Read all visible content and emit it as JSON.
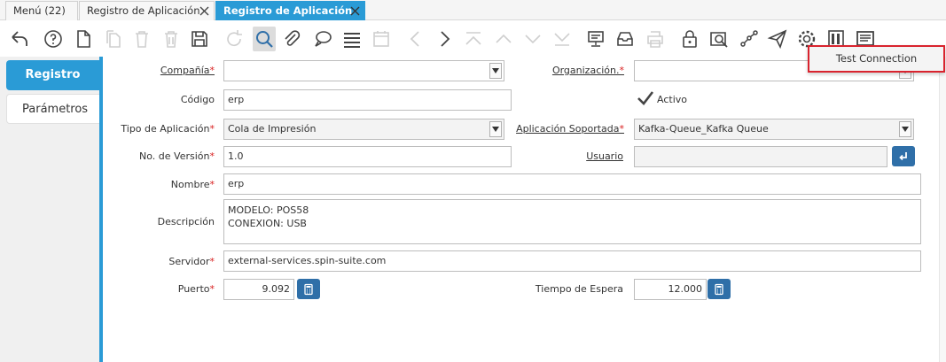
{
  "tabs": [
    {
      "label": "Menú (22)"
    },
    {
      "label": "Registro de Aplicación"
    },
    {
      "label": "Registro de Aplicación"
    }
  ],
  "left_tabs": [
    {
      "label": "Registro"
    },
    {
      "label": "Parámetros"
    }
  ],
  "form": {
    "compania": {
      "label": "Compañía",
      "value": ""
    },
    "organizacion": {
      "label": "Organización.",
      "value": ""
    },
    "codigo": {
      "label": "Código",
      "value": "erp"
    },
    "activo": {
      "label": "Activo",
      "checked": true
    },
    "tipo_aplicacion": {
      "label": "Tipo de Aplicación",
      "value": "Cola de Impresión"
    },
    "aplicacion_soportada": {
      "label": "Aplicación Soportada",
      "value": "Kafka-Queue_Kafka Queue"
    },
    "no_version": {
      "label": "No. de Versión",
      "value": "1.0"
    },
    "usuario": {
      "label": "Usuario",
      "value": ""
    },
    "nombre": {
      "label": "Nombre",
      "value": "erp"
    },
    "descripcion": {
      "label": "Descripción",
      "value": "MODELO: POS58\nCONEXION: USB"
    },
    "servidor": {
      "label": "Servidor",
      "value": "external-services.spin-suite.com"
    },
    "puerto": {
      "label": "Puerto",
      "value": "9.092"
    },
    "tiempo_espera": {
      "label": "Tiempo de Espera",
      "value": "12.000"
    }
  },
  "required_mark": "*",
  "popup": {
    "label": "Test Connection"
  },
  "colors": {
    "accent": "#2a9bd6",
    "required": "#d81e1e",
    "popup_border": "#d9232e",
    "button": "#2f6fa8"
  }
}
